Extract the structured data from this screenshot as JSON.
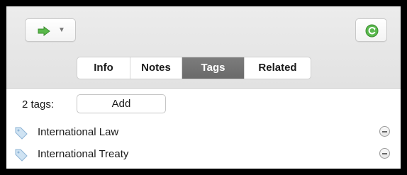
{
  "toolbar": {
    "locate_icon": "green-arrow-right-icon",
    "sync_icon": "green-sync-icon",
    "accent": "#4caf50"
  },
  "tabs": [
    {
      "label": "Info",
      "active": false
    },
    {
      "label": "Notes",
      "active": false
    },
    {
      "label": "Tags",
      "active": true
    },
    {
      "label": "Related",
      "active": false
    }
  ],
  "tags_panel": {
    "count_label": "2 tags:",
    "add_label": "Add",
    "tags": [
      {
        "label": "International Law"
      },
      {
        "label": "International Treaty"
      }
    ]
  }
}
